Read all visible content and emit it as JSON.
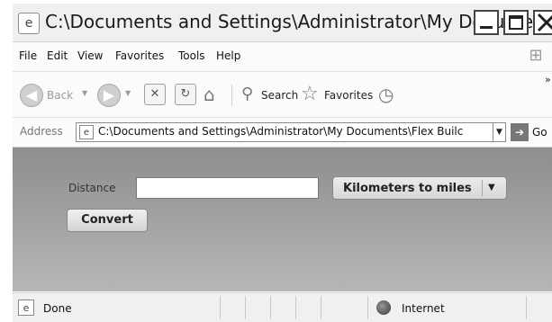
{
  "window": {
    "title": "C:\\Documents and Settings\\Administrator\\My Documen...",
    "ie_icon": "ie-page-icon"
  },
  "menu": [
    "File",
    "Edit",
    "View",
    "Favorites",
    "Tools",
    "Help"
  ],
  "toolbar": {
    "back_label": "Back",
    "search_label": "Search",
    "favorites_label": "Favorites",
    "more_chevron": "»"
  },
  "address": {
    "label": "Address",
    "url": "C:\\Documents and Settings\\Administrator\\My Documents\\Flex Builc",
    "go_label": "Go"
  },
  "app": {
    "distance_label": "Distance",
    "distance_value": "",
    "conversion_selected": "Kilometers to miles",
    "convert_button": "Convert"
  },
  "status": {
    "text": "Done",
    "zone": "Internet"
  }
}
